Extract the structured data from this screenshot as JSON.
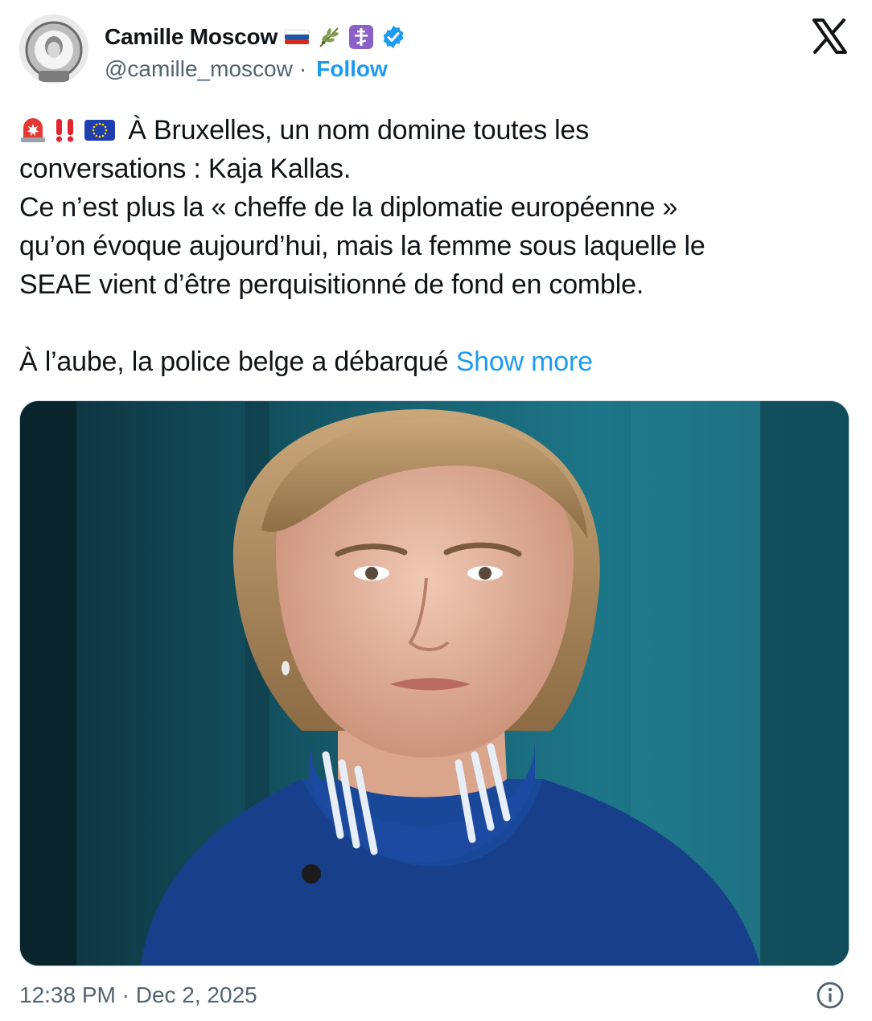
{
  "header": {
    "display_name": "Camille Moscow",
    "handle": "@camille_moscow",
    "separator": "·",
    "follow_label": "Follow",
    "badges": [
      "russia-flag-icon",
      "olive-branch-icon",
      "orthodox-cross-icon",
      "verified-badge-icon"
    ],
    "brand_icon": "x-logo-icon"
  },
  "tweet": {
    "line1": "À Bruxelles, un nom domine toutes les",
    "line2": "conversations : Kaja Kallas.",
    "line3": "Ce n’est plus la « cheffe de la diplomatie européenne »",
    "line4": "qu’on évoque aujourd’hui, mais la femme sous laquelle le",
    "line5": "SEAE vient d’être perquisitionné de fond en comble.",
    "line6": "À l’aube, la police belge a débarqué",
    "show_more": "Show more",
    "leading_emoji": [
      "rotating-light-icon",
      "double-exclamation-icon",
      "eu-flag-icon"
    ]
  },
  "media": {
    "description_icon": "photo"
  },
  "footer": {
    "timestamp": "12:38 PM · Dec 2, 2025",
    "info_icon": "info-icon"
  },
  "colors": {
    "accent": "#1d9bf0",
    "secondary_text": "#536471",
    "verified": "#1d9bf0"
  }
}
